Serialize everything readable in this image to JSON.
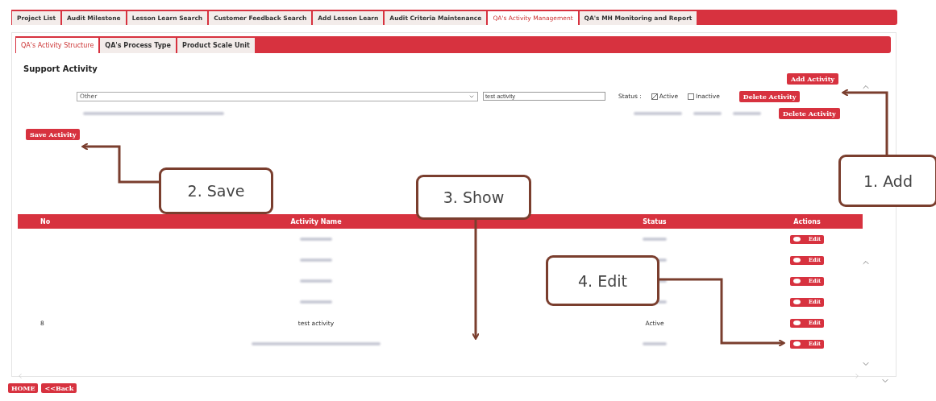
{
  "main_tabs": [
    {
      "label": "Project List",
      "selected": false
    },
    {
      "label": "Audit Milestone",
      "selected": false
    },
    {
      "label": "Lesson Learn Search",
      "selected": false
    },
    {
      "label": "Customer Feedback Search",
      "selected": false
    },
    {
      "label": "Add Lesson Learn",
      "selected": false
    },
    {
      "label": "Audit Criteria Maintenance",
      "selected": false
    },
    {
      "label": "QA's Activity Management",
      "selected": true
    },
    {
      "label": "QA's MH Monitoring and Report",
      "selected": false
    }
  ],
  "sub_tabs": [
    {
      "label": "QA's Activity Structure",
      "selected": true
    },
    {
      "label": "QA's Process Type",
      "selected": false
    },
    {
      "label": "Product Scale Unit",
      "selected": false
    }
  ],
  "section_title": "Support Activity",
  "add_button": "Add Activity",
  "form_rows": [
    {
      "kind": "edit",
      "category": "Other",
      "name": "test activity",
      "status_label": "Status :",
      "options": [
        {
          "label": "Active",
          "checked": true
        },
        {
          "label": "Inactive",
          "checked": false
        }
      ],
      "delete_button": "Delete Activity"
    },
    {
      "kind": "blurred",
      "delete_button": "Delete Activity"
    }
  ],
  "save_button": "Save Activity",
  "table": {
    "columns": [
      "No",
      "Activity Name",
      "Status",
      "Actions"
    ],
    "rows": [
      {
        "kind": "blurred",
        "edit": "Edit"
      },
      {
        "kind": "blurred",
        "edit": "Edit"
      },
      {
        "kind": "blurred",
        "edit": "Edit"
      },
      {
        "kind": "blurred",
        "edit": "Edit"
      },
      {
        "kind": "plain",
        "no": "8",
        "name": "test activity",
        "status": "Active",
        "edit": "Edit"
      },
      {
        "kind": "blurred",
        "edit": "Edit"
      }
    ]
  },
  "footer_buttons": [
    "HOME",
    "<<Back"
  ],
  "callouts": [
    {
      "text": "1. Add"
    },
    {
      "text": "2. Save"
    },
    {
      "text": "3. Show"
    },
    {
      "text": "4. Edit"
    }
  ]
}
